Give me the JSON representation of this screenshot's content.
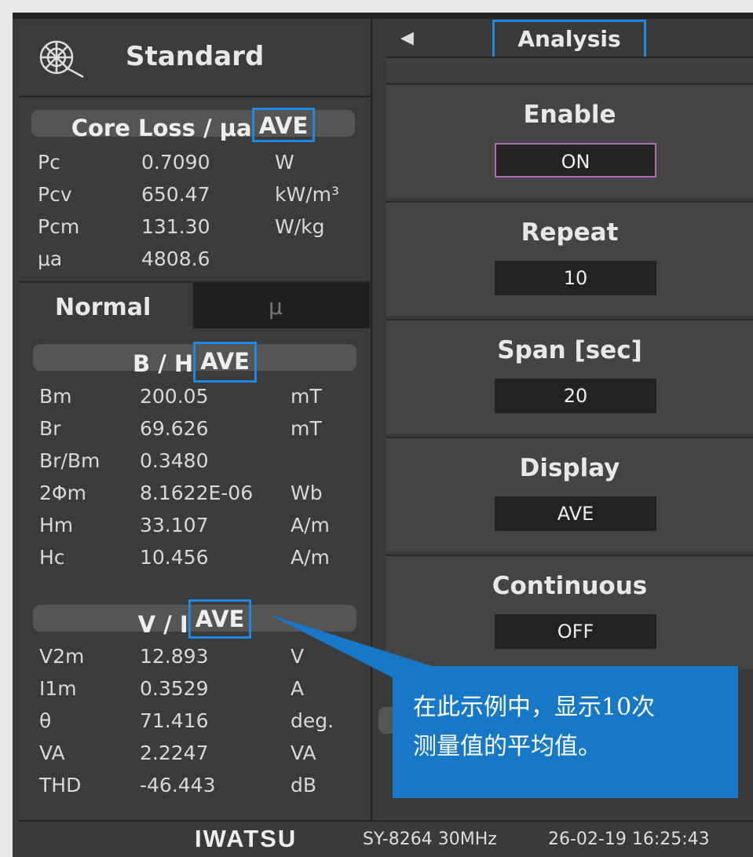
{
  "left": {
    "title": "Standard",
    "core_loss": {
      "header": "Core Loss / μa",
      "ave": "AVE",
      "rows": [
        {
          "name": "Pc",
          "value": "0.7090",
          "unit": "W"
        },
        {
          "name": "Pcv",
          "value": "650.47",
          "unit": "kW/m³"
        },
        {
          "name": "Pcm",
          "value": "131.30",
          "unit": "W/kg"
        },
        {
          "name": "μa",
          "value": "4808.6",
          "unit": ""
        }
      ]
    },
    "tabs": {
      "normal": "Normal",
      "mu": "μ"
    },
    "bh": {
      "header": "B / H",
      "ave": "AVE",
      "rows": [
        {
          "name": "Bm",
          "value": "200.05",
          "unit": "mT"
        },
        {
          "name": "Br",
          "value": "69.626",
          "unit": "mT"
        },
        {
          "name": "Br/Bm",
          "value": "0.3480",
          "unit": ""
        },
        {
          "name": "2Φm",
          "value": "8.1622E-06",
          "unit": "Wb"
        },
        {
          "name": "Hm",
          "value": "33.107",
          "unit": "A/m"
        },
        {
          "name": "Hc",
          "value": "10.456",
          "unit": "A/m"
        }
      ]
    },
    "vi": {
      "header": "V / I",
      "ave": "AVE",
      "rows": [
        {
          "name": "V2m",
          "value": "12.893",
          "unit": "V"
        },
        {
          "name": "I1m",
          "value": "0.3529",
          "unit": "A"
        },
        {
          "name": "θ",
          "value": "71.416",
          "unit": "deg."
        },
        {
          "name": "VA",
          "value": "2.2247",
          "unit": "VA"
        },
        {
          "name": "THD",
          "value": "-46.443",
          "unit": "dB"
        }
      ]
    }
  },
  "right": {
    "title": "Analysis",
    "settings": [
      {
        "label": "Enable",
        "value": "ON"
      },
      {
        "label": "Repeat",
        "value": "10"
      },
      {
        "label": "Span [sec]",
        "value": "20"
      },
      {
        "label": "Display",
        "value": "AVE"
      },
      {
        "label": "Continuous",
        "value": "OFF"
      }
    ]
  },
  "callout": {
    "line1": "在此示例中，显示10次",
    "line2": "测量值的平均值。"
  },
  "footer": {
    "brand": "IWATSU",
    "model": "SY-8264 30MHz",
    "datetime": "26-02-19 16:25:43"
  },
  "colors": {
    "highlight": "#1e88e5",
    "callout": "#1878c8",
    "enable_border": "#b06ab0"
  }
}
